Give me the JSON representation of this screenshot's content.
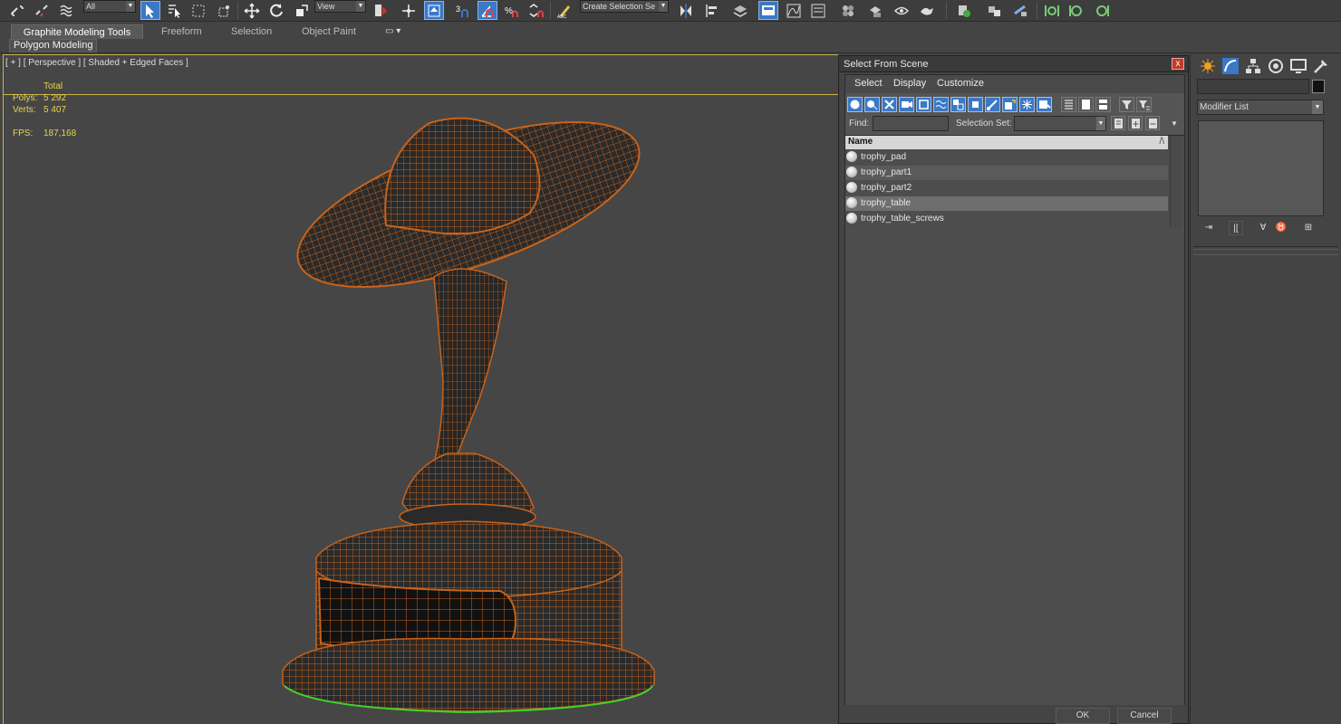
{
  "toolbar": {
    "selection_filter": "All",
    "reference_coord": "View",
    "named_selection_set": "Create Selection Se"
  },
  "ribbon": {
    "tabs": [
      "Graphite Modeling Tools",
      "Freeform",
      "Selection",
      "Object Paint"
    ],
    "active_tab": "Graphite Modeling Tools",
    "subpanel": "Polygon Modeling"
  },
  "viewport": {
    "label": "[ + ] [ Perspective ] [ Shaded + Edged Faces ]",
    "stats": {
      "header": "Total",
      "polys_label": "Polys:",
      "polys_value": "5 292",
      "verts_label": "Verts:",
      "verts_value": "5 407",
      "fps_label": "FPS:",
      "fps_value": "187,168"
    },
    "colors": {
      "wire": "#c8631b",
      "frame": "#c9b24a",
      "ground": "#3dd42a"
    }
  },
  "dialog": {
    "title": "Select From Scene",
    "close_label": "x",
    "menu": [
      "Select",
      "Display",
      "Customize"
    ],
    "find_label": "Find:",
    "find_value": "",
    "selection_set_label": "Selection Set:",
    "selection_set_value": "",
    "column_header": "Name",
    "sort_indicator": "/\\",
    "objects": [
      {
        "name": "trophy_pad"
      },
      {
        "name": "trophy_part1"
      },
      {
        "name": "trophy_part2"
      },
      {
        "name": "trophy_table"
      },
      {
        "name": "trophy_table_screws"
      }
    ],
    "selected_object": "trophy_table",
    "ok_label": "OK",
    "cancel_label": "Cancel"
  },
  "command_panel": {
    "modifier_list_label": "Modifier List",
    "object_color": "#111111"
  }
}
